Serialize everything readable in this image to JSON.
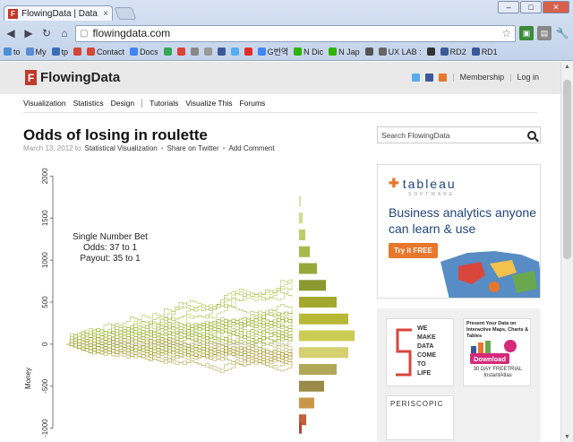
{
  "browser": {
    "tab_title": "FlowingData | Data Visualiz",
    "tab_close": "×",
    "window_buttons": [
      "–",
      "□",
      "✕"
    ],
    "url": "flowingdata.com",
    "bookmarks": [
      {
        "label": "to",
        "color": "#4a90d9"
      },
      {
        "label": "My",
        "color": "#5b8bd3"
      },
      {
        "label": "tp",
        "color": "#3b6fb6"
      },
      {
        "label": "",
        "color": "#d44638"
      },
      {
        "label": "Contact",
        "color": "#d44638"
      },
      {
        "label": "Docs",
        "color": "#4285f4"
      },
      {
        "label": "",
        "color": "#34a853"
      },
      {
        "label": "",
        "color": "#db4437"
      },
      {
        "label": "",
        "color": "#888888"
      },
      {
        "label": "",
        "color": "#999999"
      },
      {
        "label": "",
        "color": "#3b5998"
      },
      {
        "label": "",
        "color": "#55acee"
      },
      {
        "label": "",
        "color": "#e52d27"
      },
      {
        "label": "G번역",
        "color": "#4285f4"
      },
      {
        "label": "N Dic",
        "color": "#2db400"
      },
      {
        "label": "N Jap",
        "color": "#2db400"
      },
      {
        "label": "",
        "color": "#555555"
      },
      {
        "label": "UX LAB :",
        "color": "#666666"
      },
      {
        "label": "",
        "color": "#333333"
      },
      {
        "label": "RD2",
        "color": "#3a5a9a"
      },
      {
        "label": "RD1",
        "color": "#3a5a9a"
      }
    ]
  },
  "site": {
    "logo_mark": "F",
    "name": "FlowingData",
    "membership": "Membership",
    "login": "Log in",
    "nav_primary": [
      "Visualization",
      "Statistics",
      "Design"
    ],
    "nav_secondary": [
      "Tutorials",
      "Visualize This",
      "Forums"
    ],
    "search_placeholder": "Search FlowingData"
  },
  "post": {
    "title": "Odds of losing in roulette",
    "date": "March 13, 2012 to",
    "category": "Statistical Visualization",
    "bullet": "•",
    "share": "Share on Twitter",
    "comment": "Add Comment"
  },
  "ads": {
    "tableau": {
      "logo": "tableau",
      "sub": "SOFTWARE",
      "headline": "Business analytics anyone can learn & use",
      "cta": "Try it FREE"
    },
    "box2": {
      "text": [
        "WE",
        "MAKE",
        "DATA",
        "COME",
        "TO",
        "LIFE"
      ]
    },
    "box3": {
      "text": "Present Your Data on Interactive Maps, Charts & Tables",
      "download": "Download",
      "trial": "30 DAY FREETRIAL",
      "brand": "InstantAtlas"
    },
    "box4": {
      "brand": "PERISCOPIC"
    }
  },
  "chart_data": {
    "type": "line",
    "annotation": [
      "Single Number Bet",
      "Odds: 37 to 1",
      "Payout: 35 to 1"
    ],
    "ylabel": "Money",
    "yticks": [
      -1000,
      -500,
      0,
      500,
      1000,
      1500,
      2000
    ],
    "ylim": [
      -1100,
      2100
    ],
    "histogram": {
      "bins": [
        1700,
        1500,
        1300,
        1100,
        900,
        700,
        500,
        300,
        100,
        -100,
        -300,
        -500,
        -700,
        -900,
        -1000
      ],
      "widths": [
        2,
        4,
        7,
        12,
        20,
        30,
        42,
        55,
        62,
        55,
        42,
        28,
        17,
        8,
        3
      ],
      "colors": [
        "#d8e4a8",
        "#cfdc8c",
        "#bfcc6c",
        "#a8b84a",
        "#97a83a",
        "#8a9a30",
        "#a4a82c",
        "#b8b838",
        "#cccc54",
        "#d4d070",
        "#b0a858",
        "#9a8a48",
        "#c89848",
        "#c4603c",
        "#c04030"
      ]
    }
  }
}
